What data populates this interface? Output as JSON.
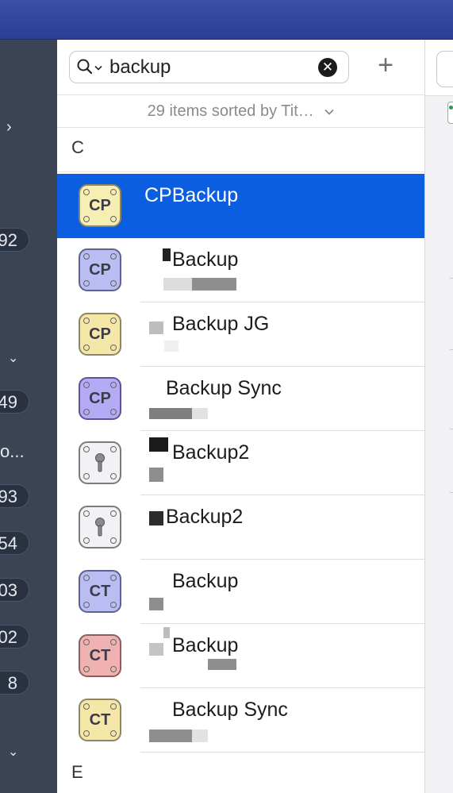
{
  "search": {
    "value": "backup"
  },
  "sort_label": "29 items sorted by Tit…",
  "sidebar": {
    "counts": [
      "92",
      "49",
      "93",
      "54",
      "03",
      "02",
      "8"
    ],
    "truncated_label": "o..."
  },
  "sections": [
    "C",
    "E"
  ],
  "items": [
    {
      "title": "CPBackup",
      "badge": "CP",
      "selected": true
    },
    {
      "title": "Backup",
      "badge": "CP"
    },
    {
      "title": "Backup JG",
      "badge": "CP"
    },
    {
      "title": "Backup Sync",
      "badge": "CP"
    },
    {
      "title": "Backup2",
      "badge": ""
    },
    {
      "title": "Backup2",
      "badge": ""
    },
    {
      "title": "Backup",
      "badge": "CT"
    },
    {
      "title": "Backup",
      "badge": "CT"
    },
    {
      "title": "Backup Sync",
      "badge": "CT"
    }
  ],
  "colors": {
    "selected_row": "#0b5ee0",
    "topbar": "#3447a0",
    "sidebar": "#3b4455",
    "badge_yellow": "#f7eeb4",
    "badge_purple": "#b9bdf2",
    "badge_violet": "#b4abf4",
    "badge_grey": "#f2f2f4",
    "badge_red": "#f0b1b1"
  },
  "icons": {
    "search": "magnifier-with-chevron",
    "clear": "x-circle",
    "add": "plus",
    "sort": "chevron-down",
    "sidebar_expand": "chevron-right",
    "sidebar_collapse": "chevron-down",
    "item_key": "keyhole"
  }
}
